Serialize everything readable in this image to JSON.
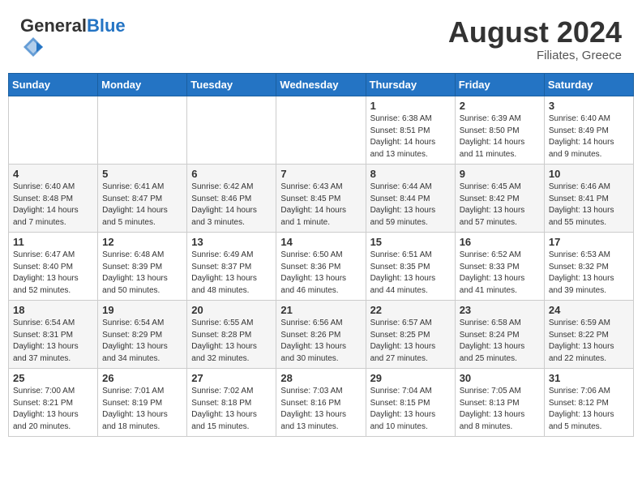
{
  "header": {
    "logo_general": "General",
    "logo_blue": "Blue",
    "month_year": "August 2024",
    "location": "Filiates, Greece"
  },
  "weekdays": [
    "Sunday",
    "Monday",
    "Tuesday",
    "Wednesday",
    "Thursday",
    "Friday",
    "Saturday"
  ],
  "weeks": [
    [
      {
        "day": "",
        "info": ""
      },
      {
        "day": "",
        "info": ""
      },
      {
        "day": "",
        "info": ""
      },
      {
        "day": "",
        "info": ""
      },
      {
        "day": "1",
        "info": "Sunrise: 6:38 AM\nSunset: 8:51 PM\nDaylight: 14 hours\nand 13 minutes."
      },
      {
        "day": "2",
        "info": "Sunrise: 6:39 AM\nSunset: 8:50 PM\nDaylight: 14 hours\nand 11 minutes."
      },
      {
        "day": "3",
        "info": "Sunrise: 6:40 AM\nSunset: 8:49 PM\nDaylight: 14 hours\nand 9 minutes."
      }
    ],
    [
      {
        "day": "4",
        "info": "Sunrise: 6:40 AM\nSunset: 8:48 PM\nDaylight: 14 hours\nand 7 minutes."
      },
      {
        "day": "5",
        "info": "Sunrise: 6:41 AM\nSunset: 8:47 PM\nDaylight: 14 hours\nand 5 minutes."
      },
      {
        "day": "6",
        "info": "Sunrise: 6:42 AM\nSunset: 8:46 PM\nDaylight: 14 hours\nand 3 minutes."
      },
      {
        "day": "7",
        "info": "Sunrise: 6:43 AM\nSunset: 8:45 PM\nDaylight: 14 hours\nand 1 minute."
      },
      {
        "day": "8",
        "info": "Sunrise: 6:44 AM\nSunset: 8:44 PM\nDaylight: 13 hours\nand 59 minutes."
      },
      {
        "day": "9",
        "info": "Sunrise: 6:45 AM\nSunset: 8:42 PM\nDaylight: 13 hours\nand 57 minutes."
      },
      {
        "day": "10",
        "info": "Sunrise: 6:46 AM\nSunset: 8:41 PM\nDaylight: 13 hours\nand 55 minutes."
      }
    ],
    [
      {
        "day": "11",
        "info": "Sunrise: 6:47 AM\nSunset: 8:40 PM\nDaylight: 13 hours\nand 52 minutes."
      },
      {
        "day": "12",
        "info": "Sunrise: 6:48 AM\nSunset: 8:39 PM\nDaylight: 13 hours\nand 50 minutes."
      },
      {
        "day": "13",
        "info": "Sunrise: 6:49 AM\nSunset: 8:37 PM\nDaylight: 13 hours\nand 48 minutes."
      },
      {
        "day": "14",
        "info": "Sunrise: 6:50 AM\nSunset: 8:36 PM\nDaylight: 13 hours\nand 46 minutes."
      },
      {
        "day": "15",
        "info": "Sunrise: 6:51 AM\nSunset: 8:35 PM\nDaylight: 13 hours\nand 44 minutes."
      },
      {
        "day": "16",
        "info": "Sunrise: 6:52 AM\nSunset: 8:33 PM\nDaylight: 13 hours\nand 41 minutes."
      },
      {
        "day": "17",
        "info": "Sunrise: 6:53 AM\nSunset: 8:32 PM\nDaylight: 13 hours\nand 39 minutes."
      }
    ],
    [
      {
        "day": "18",
        "info": "Sunrise: 6:54 AM\nSunset: 8:31 PM\nDaylight: 13 hours\nand 37 minutes."
      },
      {
        "day": "19",
        "info": "Sunrise: 6:54 AM\nSunset: 8:29 PM\nDaylight: 13 hours\nand 34 minutes."
      },
      {
        "day": "20",
        "info": "Sunrise: 6:55 AM\nSunset: 8:28 PM\nDaylight: 13 hours\nand 32 minutes."
      },
      {
        "day": "21",
        "info": "Sunrise: 6:56 AM\nSunset: 8:26 PM\nDaylight: 13 hours\nand 30 minutes."
      },
      {
        "day": "22",
        "info": "Sunrise: 6:57 AM\nSunset: 8:25 PM\nDaylight: 13 hours\nand 27 minutes."
      },
      {
        "day": "23",
        "info": "Sunrise: 6:58 AM\nSunset: 8:24 PM\nDaylight: 13 hours\nand 25 minutes."
      },
      {
        "day": "24",
        "info": "Sunrise: 6:59 AM\nSunset: 8:22 PM\nDaylight: 13 hours\nand 22 minutes."
      }
    ],
    [
      {
        "day": "25",
        "info": "Sunrise: 7:00 AM\nSunset: 8:21 PM\nDaylight: 13 hours\nand 20 minutes."
      },
      {
        "day": "26",
        "info": "Sunrise: 7:01 AM\nSunset: 8:19 PM\nDaylight: 13 hours\nand 18 minutes."
      },
      {
        "day": "27",
        "info": "Sunrise: 7:02 AM\nSunset: 8:18 PM\nDaylight: 13 hours\nand 15 minutes."
      },
      {
        "day": "28",
        "info": "Sunrise: 7:03 AM\nSunset: 8:16 PM\nDaylight: 13 hours\nand 13 minutes."
      },
      {
        "day": "29",
        "info": "Sunrise: 7:04 AM\nSunset: 8:15 PM\nDaylight: 13 hours\nand 10 minutes."
      },
      {
        "day": "30",
        "info": "Sunrise: 7:05 AM\nSunset: 8:13 PM\nDaylight: 13 hours\nand 8 minutes."
      },
      {
        "day": "31",
        "info": "Sunrise: 7:06 AM\nSunset: 8:12 PM\nDaylight: 13 hours\nand 5 minutes."
      }
    ]
  ]
}
